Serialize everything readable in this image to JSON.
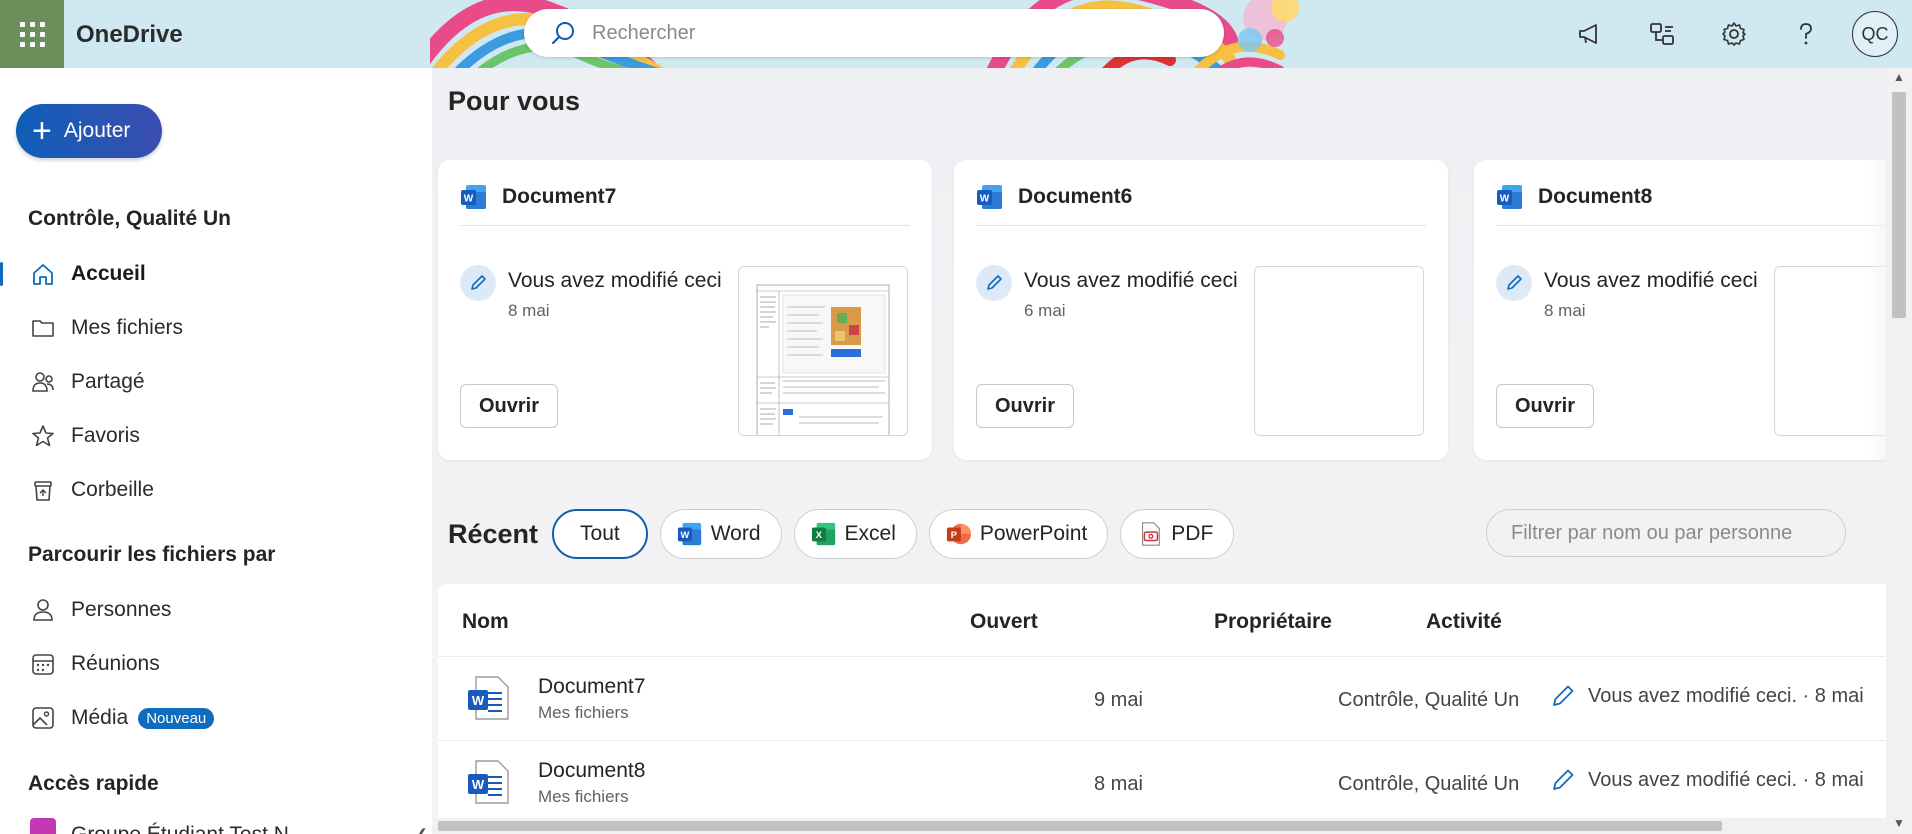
{
  "app": {
    "name": "OneDrive",
    "user_initials": "QC"
  },
  "search": {
    "placeholder": "Rechercher"
  },
  "sidebar": {
    "add_label": "Ajouter",
    "account_heading": "Contrôle, Qualité Un",
    "nav": [
      {
        "label": "Accueil",
        "icon": "home-icon",
        "active": true
      },
      {
        "label": "Mes fichiers",
        "icon": "folder-icon"
      },
      {
        "label": "Partagé",
        "icon": "people-icon"
      },
      {
        "label": "Favoris",
        "icon": "star-icon"
      },
      {
        "label": "Corbeille",
        "icon": "recycle-bin-icon"
      }
    ],
    "browse_heading": "Parcourir les fichiers par",
    "browse": [
      {
        "label": "Personnes",
        "icon": "person-icon"
      },
      {
        "label": "Réunions",
        "icon": "calendar-icon"
      },
      {
        "label": "Média",
        "icon": "image-icon",
        "badge": "Nouveau"
      }
    ],
    "quick_heading": "Accès rapide",
    "quick_item_partial": "Groupe Étudiant Test N..."
  },
  "main": {
    "for_you_title": "Pour vous",
    "cards": [
      {
        "title": "Document7",
        "activity": "Vous avez modifié ceci",
        "date": "8 mai",
        "open_label": "Ouvrir",
        "has_preview": true
      },
      {
        "title": "Document6",
        "activity": "Vous avez modifié ceci",
        "date": "6 mai",
        "open_label": "Ouvrir",
        "has_preview": false
      },
      {
        "title": "Document8",
        "activity": "Vous avez modifié ceci",
        "date": "8 mai",
        "open_label": "Ouvrir",
        "has_preview": false
      }
    ],
    "recent_title": "Récent",
    "filters": [
      {
        "label": "Tout",
        "selected": true
      },
      {
        "label": "Word",
        "icon": "word-icon"
      },
      {
        "label": "Excel",
        "icon": "excel-icon"
      },
      {
        "label": "PowerPoint",
        "icon": "powerpoint-icon"
      },
      {
        "label": "PDF",
        "icon": "pdf-icon"
      }
    ],
    "filter_placeholder": "Filtrer par nom ou par personne",
    "table": {
      "headers": [
        "Nom",
        "Ouvert",
        "Propriétaire",
        "Activité"
      ],
      "rows": [
        {
          "name": "Document7",
          "location": "Mes fichiers",
          "opened": "9 mai",
          "owner": "Contrôle, Qualité Un",
          "activity": "Vous avez modifié ceci. · 8 mai"
        },
        {
          "name": "Document8",
          "location": "Mes fichiers",
          "opened": "8 mai",
          "owner": "Contrôle, Qualité Un",
          "activity": "Vous avez modifié ceci. · 8 mai"
        }
      ]
    }
  },
  "colors": {
    "accent": "#0f6cbd",
    "word": "#185abd",
    "excel": "#107c41",
    "powerpoint": "#c43e1c",
    "pdf": "#d13438",
    "waffle_bg": "#6b8f5b"
  }
}
